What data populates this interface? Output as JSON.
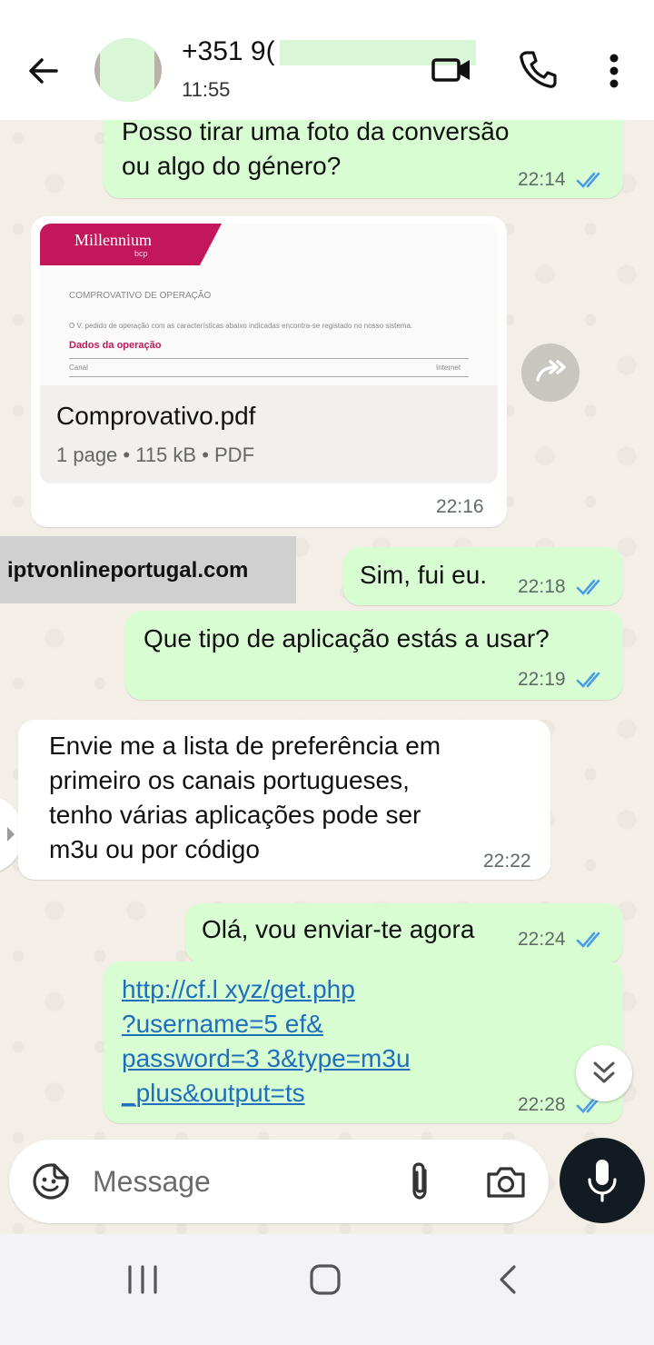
{
  "header": {
    "contact_name": "+351 9(",
    "last_seen": "11:55",
    "icons": [
      "back-arrow-icon",
      "avatar",
      "video-call-icon",
      "phone-icon",
      "more-vert-icon"
    ]
  },
  "messages": [
    {
      "id": "m1",
      "direction": "outgoing",
      "lines": [
        "Posso tirar uma foto da conversão",
        "ou algo do género?"
      ],
      "time": "22:14",
      "status": "read"
    },
    {
      "id": "m2",
      "direction": "incoming",
      "type": "document",
      "preview": {
        "brand": "Millennium",
        "brand_sub": "bcp",
        "title": "COMPROVATIVO DE OPERAÇÃO",
        "body": "O V. pedido de operação com as características abaixo indicadas encontra-se registado no nosso sistema.",
        "section": "Dados da operação",
        "row_label": "Canal",
        "row_value": "Internet"
      },
      "file_name": "Comprovativo.pdf",
      "file_meta": "1 page • 115 kB • PDF",
      "time": "22:16"
    },
    {
      "id": "m3",
      "direction": "outgoing",
      "lines": [
        "Sim, fui eu."
      ],
      "time": "22:18",
      "status": "read"
    },
    {
      "id": "m4",
      "direction": "outgoing",
      "lines": [
        "Que tipo de aplicação estás a usar?"
      ],
      "time": "22:19",
      "status": "read"
    },
    {
      "id": "m5",
      "direction": "incoming",
      "lines": [
        "Envie me a lista  de preferência em",
        "primeiro os canais portugueses,",
        "tenho várias aplicações pode ser",
        "m3u ou por código"
      ],
      "time": "22:22"
    },
    {
      "id": "m6",
      "direction": "outgoing",
      "lines": [
        "Olá, vou enviar-te agora"
      ],
      "time": "22:24",
      "status": "read"
    },
    {
      "id": "m7",
      "direction": "outgoing",
      "type": "link",
      "lines": [
        "http://cf.l                      xyz/get.php",
        "?username=5         ef&",
        "password=3          3&type=m3u",
        "_plus&output=ts"
      ],
      "time": "22:28",
      "status": "read"
    }
  ],
  "watermark": "iptvonlineportugal.com",
  "composer": {
    "placeholder": "Message",
    "icons": [
      "emoji-sticker-icon",
      "attach-icon",
      "camera-icon",
      "mic-icon"
    ]
  },
  "navbar": {
    "icons": [
      "recent-apps-icon",
      "home-icon",
      "back-icon"
    ]
  },
  "colors": {
    "outgoing_bubble": "#d9fdd3",
    "incoming_bubble": "#ffffff",
    "read_ticks": "#4a9be8",
    "link": "#1f6fbf"
  }
}
